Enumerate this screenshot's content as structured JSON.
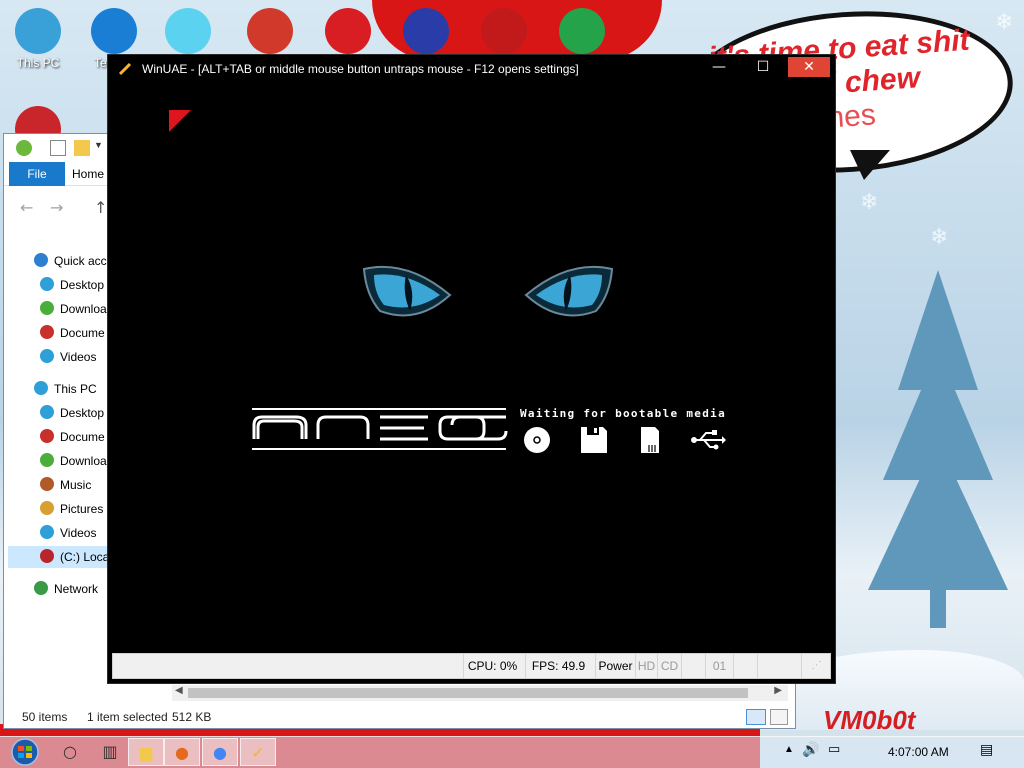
{
  "desktop": {
    "icons": [
      {
        "label": "This PC",
        "icon": "this-pc-icon",
        "color": "#3aa0d8"
      },
      {
        "label": "Te\nForc",
        "icon": "settings-gear-icon",
        "color": "#1a7fd4"
      },
      {
        "label": "",
        "icon": "diamond-icon",
        "color": "#5ad2f0"
      },
      {
        "label": "",
        "icon": "p-logo-icon",
        "color": "#d13a2a"
      },
      {
        "label": "",
        "icon": "angry-bird-icon",
        "color": "#d81e22"
      },
      {
        "label": "",
        "icon": "ornament-icon",
        "color": "#2a3ca8"
      },
      {
        "label": "",
        "icon": "gift-icon",
        "color": "#c21a1a"
      },
      {
        "label": "",
        "icon": "game-icon",
        "color": "#24a34a"
      }
    ],
    "speech_bubble": [
      "it's time to eat shit",
      "nd chew",
      "tanes"
    ],
    "corner_text": "VM0b0t"
  },
  "explorer": {
    "tabs": {
      "file": "File",
      "home": "Home"
    },
    "tree": [
      {
        "label": "Quick acce",
        "icon": "star-icon",
        "color": "#2f7fd0",
        "indent": 0
      },
      {
        "label": "Desktop",
        "icon": "desktop-icon",
        "color": "#2f9fd8",
        "indent": 1
      },
      {
        "label": "Downloa",
        "icon": "downloads-icon",
        "color": "#4cae3a",
        "indent": 1
      },
      {
        "label": "Docume",
        "icon": "documents-icon",
        "color": "#c9302c",
        "indent": 1
      },
      {
        "label": "Videos",
        "icon": "videos-icon",
        "color": "#2f9fd8",
        "indent": 1
      },
      {
        "label": "This PC",
        "icon": "this-pc-icon",
        "color": "#2f9fd8",
        "indent": 0
      },
      {
        "label": "Desktop",
        "icon": "desktop-icon",
        "color": "#2f9fd8",
        "indent": 1
      },
      {
        "label": "Docume",
        "icon": "documents-icon",
        "color": "#c9302c",
        "indent": 1
      },
      {
        "label": "Downloa",
        "icon": "downloads-icon",
        "color": "#4cae3a",
        "indent": 1
      },
      {
        "label": "Music",
        "icon": "music-icon",
        "color": "#b05a2a",
        "indent": 1
      },
      {
        "label": "Pictures",
        "icon": "pictures-icon",
        "color": "#d8a030",
        "indent": 1
      },
      {
        "label": "Videos",
        "icon": "videos-icon",
        "color": "#2f9fd8",
        "indent": 1
      },
      {
        "label": "(C:) Loca",
        "icon": "drive-icon",
        "color": "#b8252a",
        "indent": 1,
        "selected": true
      },
      {
        "label": "Network",
        "icon": "network-icon",
        "color": "#3a9a46",
        "indent": 0
      }
    ],
    "status": {
      "items": "50 items",
      "selected": "1 item selected",
      "size": "512 KB"
    }
  },
  "winuae": {
    "title": "WinUAE - [ALT+TAB or middle mouse button untraps mouse - F12 opens settings]",
    "boot_message": "Waiting for bootable media",
    "boot_icons": [
      "cd-icon",
      "floppy-icon",
      "sd-card-icon",
      "usb-icon"
    ],
    "status": {
      "cpu": "CPU: 0%",
      "fps": "FPS: 49.9",
      "power": "Power",
      "hd": "HD",
      "cd": "CD",
      "drive": "01"
    }
  },
  "taskbar": {
    "clock": "4:07:00 AM",
    "apps": [
      "search-icon",
      "task-view-icon",
      "file-explorer-icon",
      "firefox-icon",
      "chrome-icon",
      "winuae-icon"
    ]
  }
}
